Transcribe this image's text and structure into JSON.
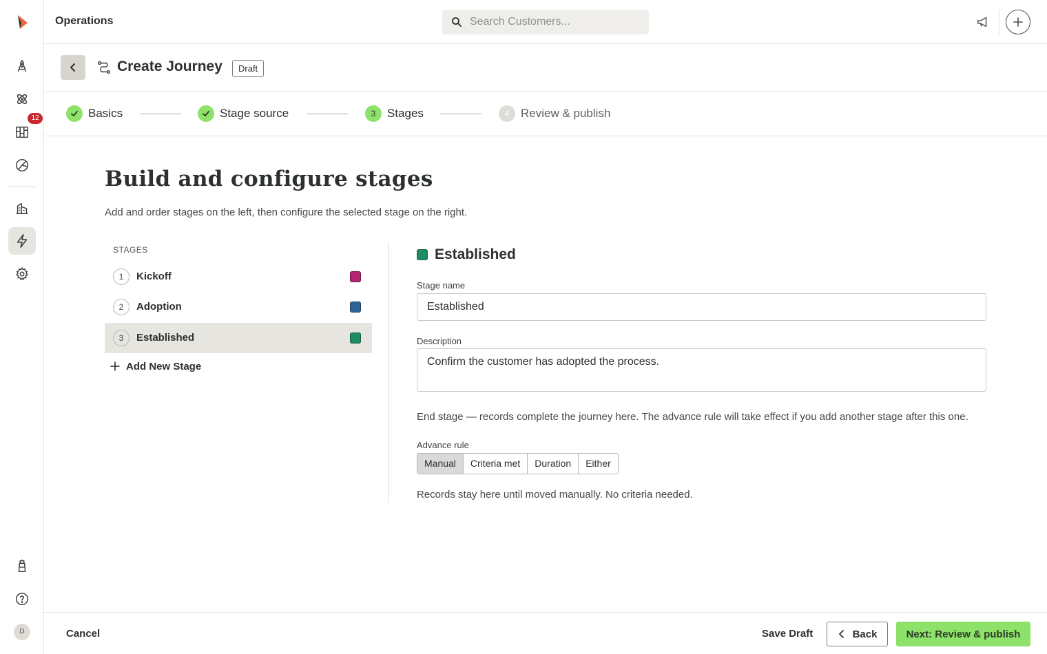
{
  "app": {
    "title": "Operations"
  },
  "search": {
    "placeholder": "Search Customers..."
  },
  "rail": {
    "notifications_badge": "12",
    "avatar_initial": "D"
  },
  "header": {
    "title": "Create Journey",
    "badge": "Draft"
  },
  "stepper": {
    "steps": [
      {
        "number": "1",
        "label": "Basics",
        "state": "done"
      },
      {
        "number": "2",
        "label": "Stage source",
        "state": "done"
      },
      {
        "number": "3",
        "label": "Stages",
        "state": "current"
      },
      {
        "number": "4",
        "label": "Review & publish",
        "state": "pending"
      }
    ]
  },
  "main": {
    "heading": "Build and configure stages",
    "subheading": "Add and order stages on the left, then configure the selected stage on the right."
  },
  "stages": {
    "title": "STAGES",
    "items": [
      {
        "number": "1",
        "name": "Kickoff",
        "color": "#b3266f"
      },
      {
        "number": "2",
        "name": "Adoption",
        "color": "#2b6494"
      },
      {
        "number": "3",
        "name": "Established",
        "color": "#1f8c62"
      }
    ],
    "selected_index": 2,
    "add_label": "Add New Stage"
  },
  "config": {
    "title": "Established",
    "color": "#1f8c62",
    "stage_name_label": "Stage name",
    "stage_name_value": "Established",
    "description_label": "Description",
    "description_value": "Confirm the customer has adopted the process.",
    "end_stage_note": "End stage — records complete the journey here. The advance rule will take effect if you add another stage after this one.",
    "advance_rule_label": "Advance rule",
    "advance_rule_options": [
      "Manual",
      "Criteria met",
      "Duration",
      "Either"
    ],
    "advance_rule_selected": "Manual",
    "advance_rule_hint": "Records stay here until moved manually. No criteria needed."
  },
  "footer": {
    "cancel": "Cancel",
    "save_draft": "Save Draft",
    "back": "Back",
    "next": "Next: Review & publish"
  },
  "colors": {
    "accent_green": "#8ee26a",
    "badge_red": "#c8282e",
    "selected_bg": "#e6e5df"
  }
}
